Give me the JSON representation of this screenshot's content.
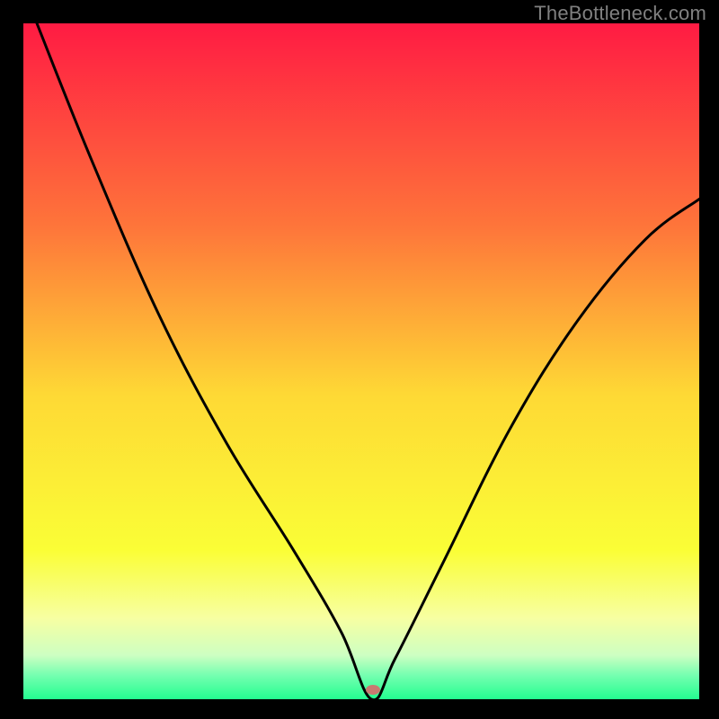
{
  "watermark": "TheBottleneck.com",
  "chart_data": {
    "type": "line",
    "title": "",
    "xlabel": "",
    "ylabel": "",
    "xlim": [
      0,
      100
    ],
    "ylim": [
      0,
      100
    ],
    "grid": false,
    "series": [
      {
        "name": "bottleneck-curve",
        "x": [
          2,
          10,
          20,
          30,
          40,
          47,
          51.5,
          55,
          62,
          72,
          82,
          92,
          100
        ],
        "values": [
          100,
          80,
          57,
          38,
          22,
          10,
          0,
          6,
          20,
          40,
          56,
          68,
          74
        ]
      }
    ],
    "marker": {
      "x": 51.8,
      "y": 0,
      "color": "#C97A71"
    },
    "gradient_stops": [
      {
        "offset": 0.0,
        "color": "#FF1B43"
      },
      {
        "offset": 0.3,
        "color": "#FE753A"
      },
      {
        "offset": 0.55,
        "color": "#FED935"
      },
      {
        "offset": 0.78,
        "color": "#FAFE36"
      },
      {
        "offset": 0.88,
        "color": "#F7FFA2"
      },
      {
        "offset": 0.935,
        "color": "#CDFFC2"
      },
      {
        "offset": 0.965,
        "color": "#74FFB0"
      },
      {
        "offset": 1.0,
        "color": "#23FD90"
      }
    ]
  }
}
